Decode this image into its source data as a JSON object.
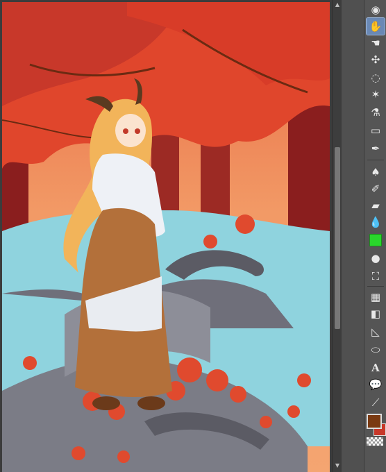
{
  "canvas": {
    "artwork": "autumn-maple-girl-illustration"
  },
  "toolbar": {
    "tools": [
      {
        "name": "rotate-tool",
        "icon": "rotate-icon",
        "active": false
      },
      {
        "name": "hand-tool",
        "icon": "hand-icon",
        "active": true
      },
      {
        "name": "object-tool",
        "icon": "object-icon",
        "active": false
      },
      {
        "name": "operation-tool",
        "icon": "move-icon",
        "active": false
      },
      {
        "name": "lasso-tool",
        "icon": "lasso-icon",
        "active": false
      },
      {
        "name": "magic-wand-tool",
        "icon": "magic-wand-icon",
        "active": false
      },
      {
        "name": "eyedropper-tool",
        "icon": "eyedropper-icon",
        "active": false
      },
      {
        "name": "eraser-tool",
        "icon": "eraser-icon",
        "active": false
      },
      {
        "name": "pen-tool",
        "icon": "pen-icon",
        "active": false
      },
      {
        "name": "brush-tool",
        "icon": "brush-icon",
        "active": false
      },
      {
        "name": "airbrush-tool",
        "icon": "airbrush-icon",
        "active": false
      },
      {
        "name": "soft-eraser-tool",
        "icon": "soft-eraser-icon",
        "active": false
      },
      {
        "name": "blend-tool",
        "icon": "water-drop-icon",
        "active": false
      },
      {
        "name": "decoration-tool",
        "icon": "decoration-icon",
        "active": false
      },
      {
        "name": "fill-tool",
        "icon": "fill-drop-icon",
        "active": false
      },
      {
        "name": "paint-bucket-tool",
        "icon": "paint-bucket-icon",
        "active": false
      },
      {
        "name": "frame-tool",
        "icon": "frame-icon",
        "active": false
      },
      {
        "name": "gradient-tool",
        "icon": "gradient-icon",
        "active": false
      },
      {
        "name": "ruler-tool",
        "icon": "ruler-icon",
        "active": false
      },
      {
        "name": "figure-tool",
        "icon": "ellipse-icon",
        "active": false
      },
      {
        "name": "text-tool",
        "icon": "text-icon",
        "active": false
      },
      {
        "name": "balloon-tool",
        "icon": "balloon-icon",
        "active": false
      },
      {
        "name": "correct-line-tool",
        "icon": "correct-line-icon",
        "active": false
      }
    ],
    "text_tool_label": "A"
  },
  "colors": {
    "main_color": "#7a3a12",
    "sub_color": "#c8382a",
    "transparent": "transparent",
    "sky": "#ef8a5c",
    "water": "#8fd3de",
    "stone": "#6f6f7a",
    "maple": "#e0462c",
    "trunk": "#8a1e1e"
  }
}
